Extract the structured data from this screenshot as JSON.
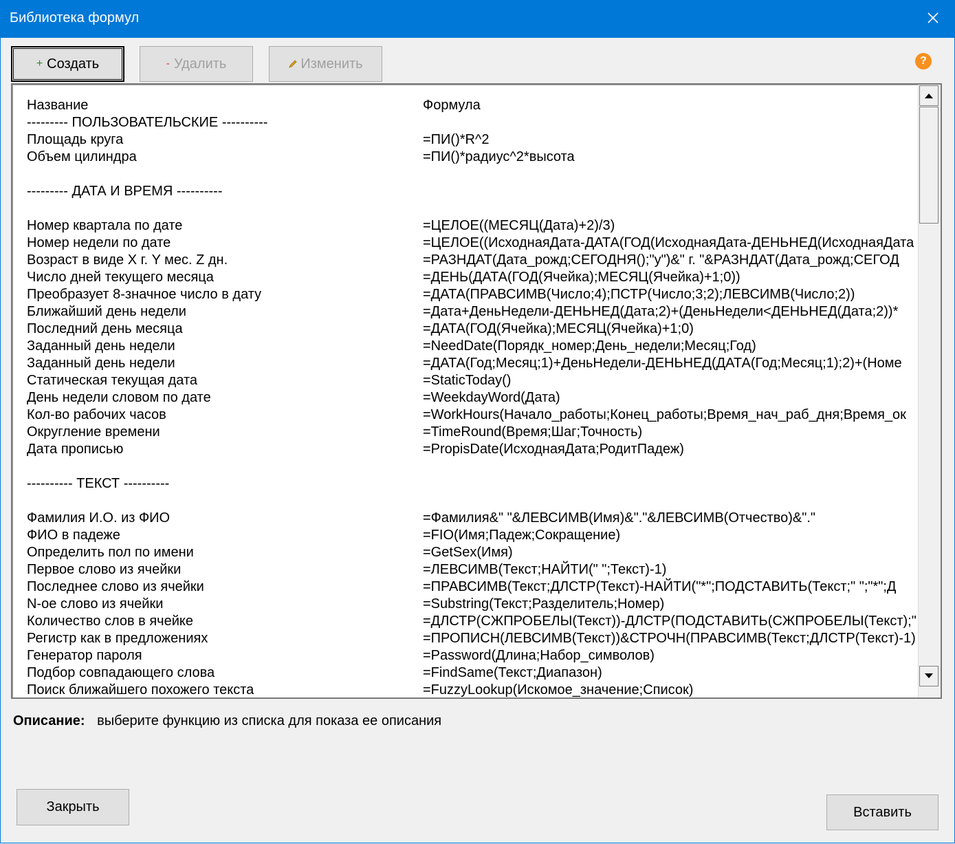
{
  "window": {
    "title": "Библиотека формул"
  },
  "toolbar": {
    "create_label": "Создать",
    "delete_label": "Удалить",
    "edit_label": "Изменить",
    "help_label": "?"
  },
  "list": {
    "header_name": "Название",
    "header_formula": "Формула",
    "rows": [
      {
        "name": "--------- ПОЛЬЗОВАТЕЛЬСКИЕ ----------",
        "formula": ""
      },
      {
        "name": "Площадь круга",
        "formula": "=ПИ()*R^2"
      },
      {
        "name": "Объем цилиндра",
        "formula": "=ПИ()*радиус^2*высота"
      },
      {
        "name": "",
        "formula": ""
      },
      {
        "name": "--------- ДАТА И ВРЕМЯ ----------",
        "formula": ""
      },
      {
        "name": "",
        "formula": ""
      },
      {
        "name": "Номер квартала по дате",
        "formula": "=ЦЕЛОЕ((МЕСЯЦ(Дата)+2)/3)"
      },
      {
        "name": "Номер недели по дате",
        "formula": "=ЦЕЛОЕ((ИсходнаяДата-ДАТА(ГОД(ИсходнаяДата-ДЕНЬНЕД(ИсходнаяДата"
      },
      {
        "name": "Возраст в виде X г. Y мес. Z дн.",
        "formula": "=РАЗНДАТ(Дата_рожд;СЕГОДНЯ();\"y\")&\" г. \"&РАЗНДАТ(Дата_рожд;СЕГОД"
      },
      {
        "name": "Число дней текущего месяца",
        "formula": "=ДЕНЬ(ДАТА(ГОД(Ячейка);МЕСЯЦ(Ячейка)+1;0))"
      },
      {
        "name": "Преобразует 8-значное число в дату",
        "formula": "=ДАТА(ПРАВСИМВ(Число;4);ПСТР(Число;3;2);ЛЕВСИМВ(Число;2))"
      },
      {
        "name": "Ближайший день недели",
        "formula": "=Дата+ДеньНедели-ДЕНЬНЕД(Дата;2)+(ДеньНедели<ДЕНЬНЕД(Дата;2))*"
      },
      {
        "name": "Последний день месяца",
        "formula": "=ДАТА(ГОД(Ячейка);МЕСЯЦ(Ячейка)+1;0)"
      },
      {
        "name": "Заданный день недели",
        "formula": "=NeedDate(Порядк_номер;День_недели;Месяц;Год)"
      },
      {
        "name": "Заданный день недели",
        "formula": "=ДАТА(Год;Месяц;1)+ДеньНедели-ДЕНЬНЕД(ДАТА(Год;Месяц;1);2)+(Номе"
      },
      {
        "name": "Статическая текущая дата",
        "formula": "=StaticToday()"
      },
      {
        "name": "День недели словом по дате",
        "formula": "=WeekdayWord(Дата)"
      },
      {
        "name": "Кол-во рабочих часов",
        "formula": "=WorkHours(Начало_работы;Конец_работы;Время_нач_раб_дня;Время_ок"
      },
      {
        "name": "Округление времени",
        "formula": "=TimeRound(Время;Шаг;Точность)"
      },
      {
        "name": "Дата прописью",
        "formula": "=PropisDate(ИсходнаяДата;РодитПадеж)"
      },
      {
        "name": "",
        "formula": ""
      },
      {
        "name": "---------- ТЕКСТ ----------",
        "formula": ""
      },
      {
        "name": "",
        "formula": ""
      },
      {
        "name": "Фамилия И.О. из ФИО",
        "formula": "=Фамилия&\" \"&ЛЕВСИМВ(Имя)&\".\"&ЛЕВСИМВ(Отчество)&\".\""
      },
      {
        "name": "ФИО в падеже",
        "formula": "=FIO(Имя;Падеж;Сокращение)"
      },
      {
        "name": "Определить пол по имени",
        "formula": "=GetSex(Имя)"
      },
      {
        "name": "Первое слово из ячейки",
        "formula": "=ЛЕВСИМВ(Текст;НАЙТИ(\" \";Текст)-1)"
      },
      {
        "name": "Последнее слово из ячейки",
        "formula": "=ПРАВСИМВ(Текст;ДЛСТР(Текст)-НАЙТИ(\"*\";ПОДСТАВИТЬ(Текст;\" \";\"*\";Д"
      },
      {
        "name": "N-ое слово из ячейки",
        "formula": "=Substring(Текст;Разделитель;Номер)"
      },
      {
        "name": "Количество слов в ячейке",
        "formula": "=ДЛСТР(СЖПРОБЕЛЫ(Текст))-ДЛСТР(ПОДСТАВИТЬ(СЖПРОБЕЛЫ(Текст);\""
      },
      {
        "name": "Регистр как в предложениях",
        "formula": "=ПРОПИСН(ЛЕВСИМВ(Текст))&СТРОЧН(ПРАВСИМВ(Текст;ДЛСТР(Текст)-1)"
      },
      {
        "name": "Генератор пароля",
        "formula": "=Password(Длина;Набор_символов)"
      },
      {
        "name": "Подбор совпадающего слова",
        "formula": "=FindSame(Текст;Диапазон)"
      },
      {
        "name": "Поиск ближайшего похожего текста",
        "formula": "=FuzzyLookup(Искомое_значение;Список)"
      }
    ]
  },
  "description": {
    "label": "Описание:",
    "text": "выберите функцию из списка для показа ее описания"
  },
  "footer": {
    "close_label": "Закрыть",
    "insert_label": "Вставить"
  },
  "colors": {
    "titlebar": "#0078d7",
    "help_badge": "#f7901e",
    "create_icon": "#2e8b2e",
    "delete_icon": "#e04040",
    "edit_icon": "#d4a020"
  }
}
